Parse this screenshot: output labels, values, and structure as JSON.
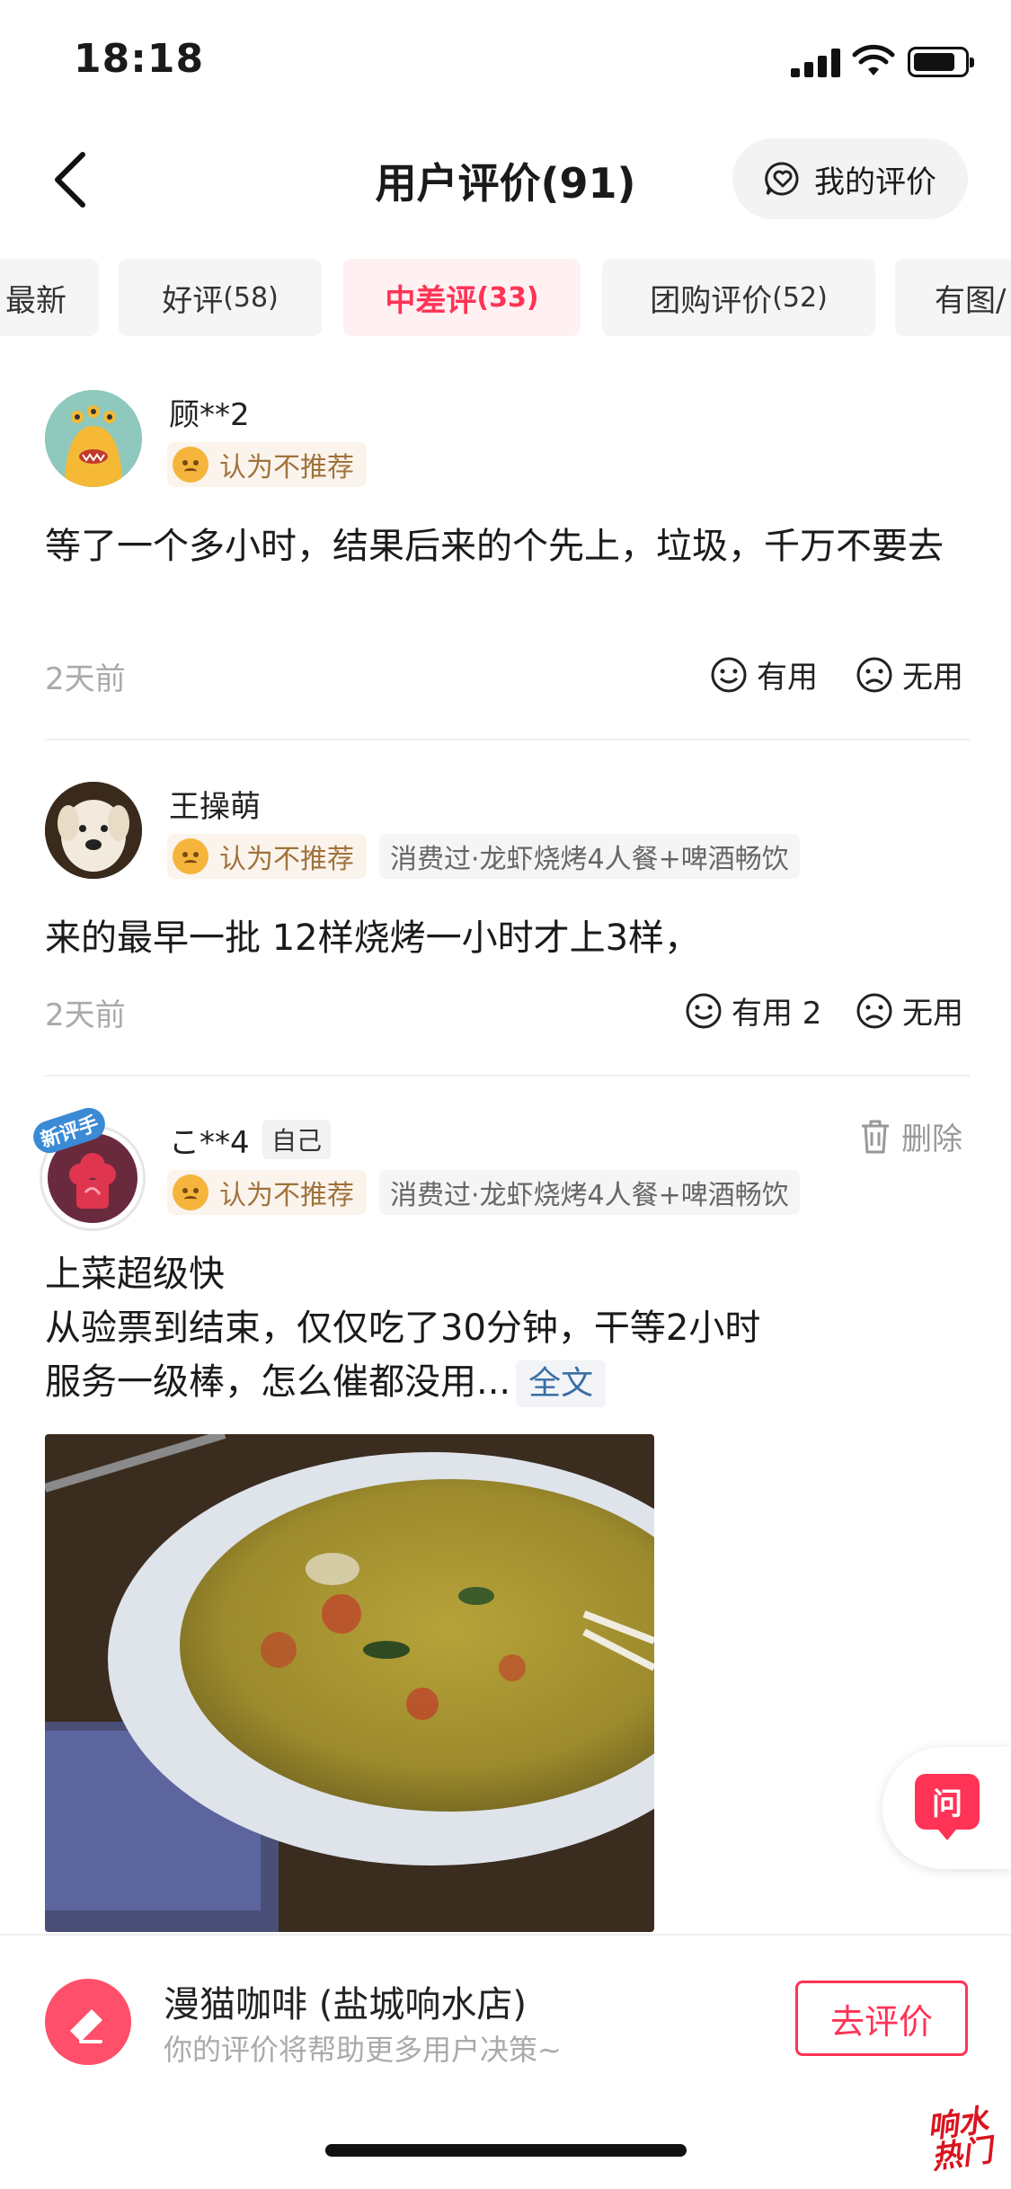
{
  "status_bar": {
    "time": "18:18"
  },
  "header": {
    "title": "用户评价(91)",
    "my_review": "我的评价"
  },
  "tabs": [
    {
      "label": "最新",
      "count": ""
    },
    {
      "label": "好评",
      "count": "(58)"
    },
    {
      "label": "中差评",
      "count": "(33)"
    },
    {
      "label": "团购评价",
      "count": "(52)"
    },
    {
      "label": "有图/",
      "count": ""
    }
  ],
  "reviews": [
    {
      "user": "顾**2",
      "recommend": "认为不推荐",
      "consumed": "",
      "content": "等了一个多小时，结果后来的个先上，垃圾，千万不要去",
      "time": "2天前",
      "useful": "有用",
      "useless": "无用"
    },
    {
      "user": "王操萌",
      "recommend": "认为不推荐",
      "consumed": "消费过·龙虾烧烤4人餐+啤酒畅饮",
      "content": "来的最早一批 12样烧烤一小时才上3样，",
      "time": "2天前",
      "useful": "有用 2",
      "useless": "无用"
    },
    {
      "user": "こ**4",
      "self_tag": "自己",
      "new_badge": "新评手",
      "delete": "删除",
      "recommend": "认为不推荐",
      "consumed": "消费过·龙虾烧烤4人餐+啤酒畅饮",
      "lines": [
        "上菜超级快",
        "从验票到结束，仅仅吃了30分钟，干等2小时",
        "服务一级棒，怎么催都没用..."
      ],
      "full_text": "全文"
    }
  ],
  "ask": {
    "label": "问"
  },
  "bottom": {
    "shop_name": "漫猫咖啡 (盐城响水店)",
    "hint": "你的评价将帮助更多用户决策~",
    "button": "去评价"
  },
  "watermark": "响水热门",
  "battery_level": 0.8,
  "colors": {
    "accent": "#ff3355",
    "tag_bg": "#fbf4ec",
    "tag_text": "#a0723c"
  }
}
